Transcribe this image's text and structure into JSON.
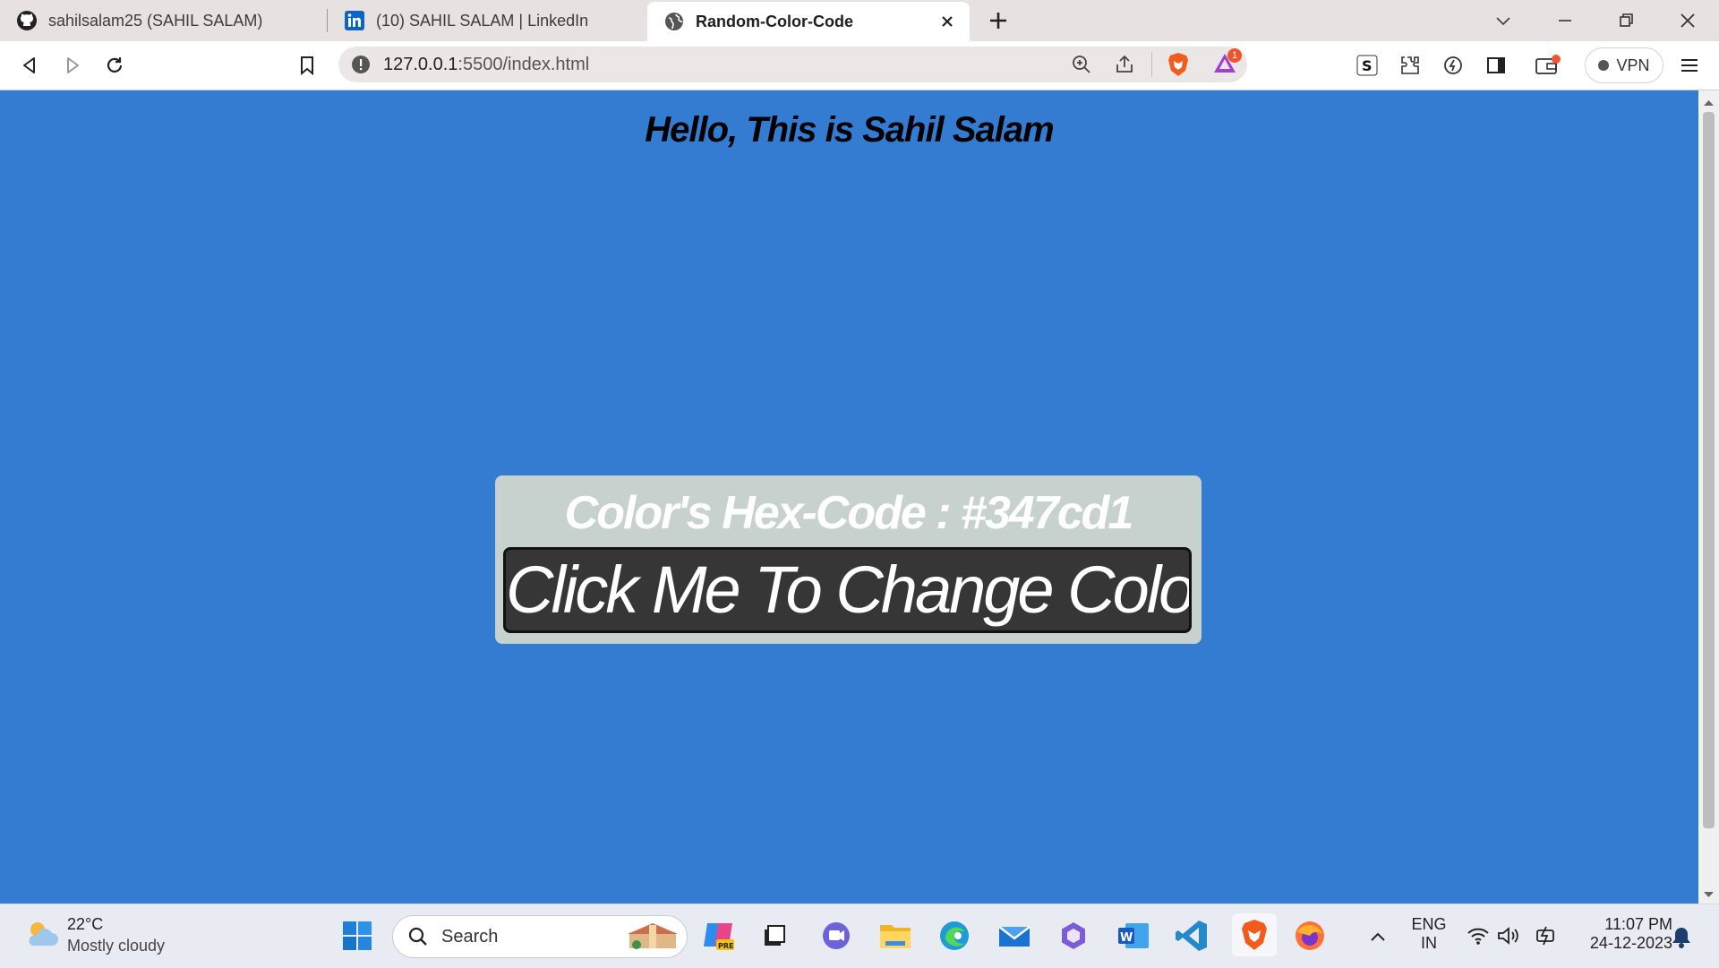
{
  "browser": {
    "tabs": [
      {
        "label": "sahilsalam25 (SAHIL SALAM)",
        "icon": "github-icon",
        "active": false
      },
      {
        "label": "(10) SAHIL SALAM | LinkedIn",
        "icon": "linkedin-icon",
        "active": false
      },
      {
        "label": "Random-Color-Code",
        "icon": "globe-icon",
        "active": true
      }
    ],
    "url_host": "127.0.0.1",
    "url_rest": ":5500/index.html",
    "vpn_label": "VPN",
    "brave_rewards_badge": "1"
  },
  "page": {
    "background": "#347cd1",
    "title": "Hello, This is Sahil Salam",
    "hex_label": "Color's Hex-Code : #347cd1",
    "button_label": "Click Me To Change Color"
  },
  "taskbar": {
    "weather_temp": "22°C",
    "weather_desc": "Mostly cloudy",
    "search_placeholder": "Search",
    "lang_top": "ENG",
    "lang_bottom": "IN",
    "time": "11:07 PM",
    "date": "24-12-2023"
  }
}
